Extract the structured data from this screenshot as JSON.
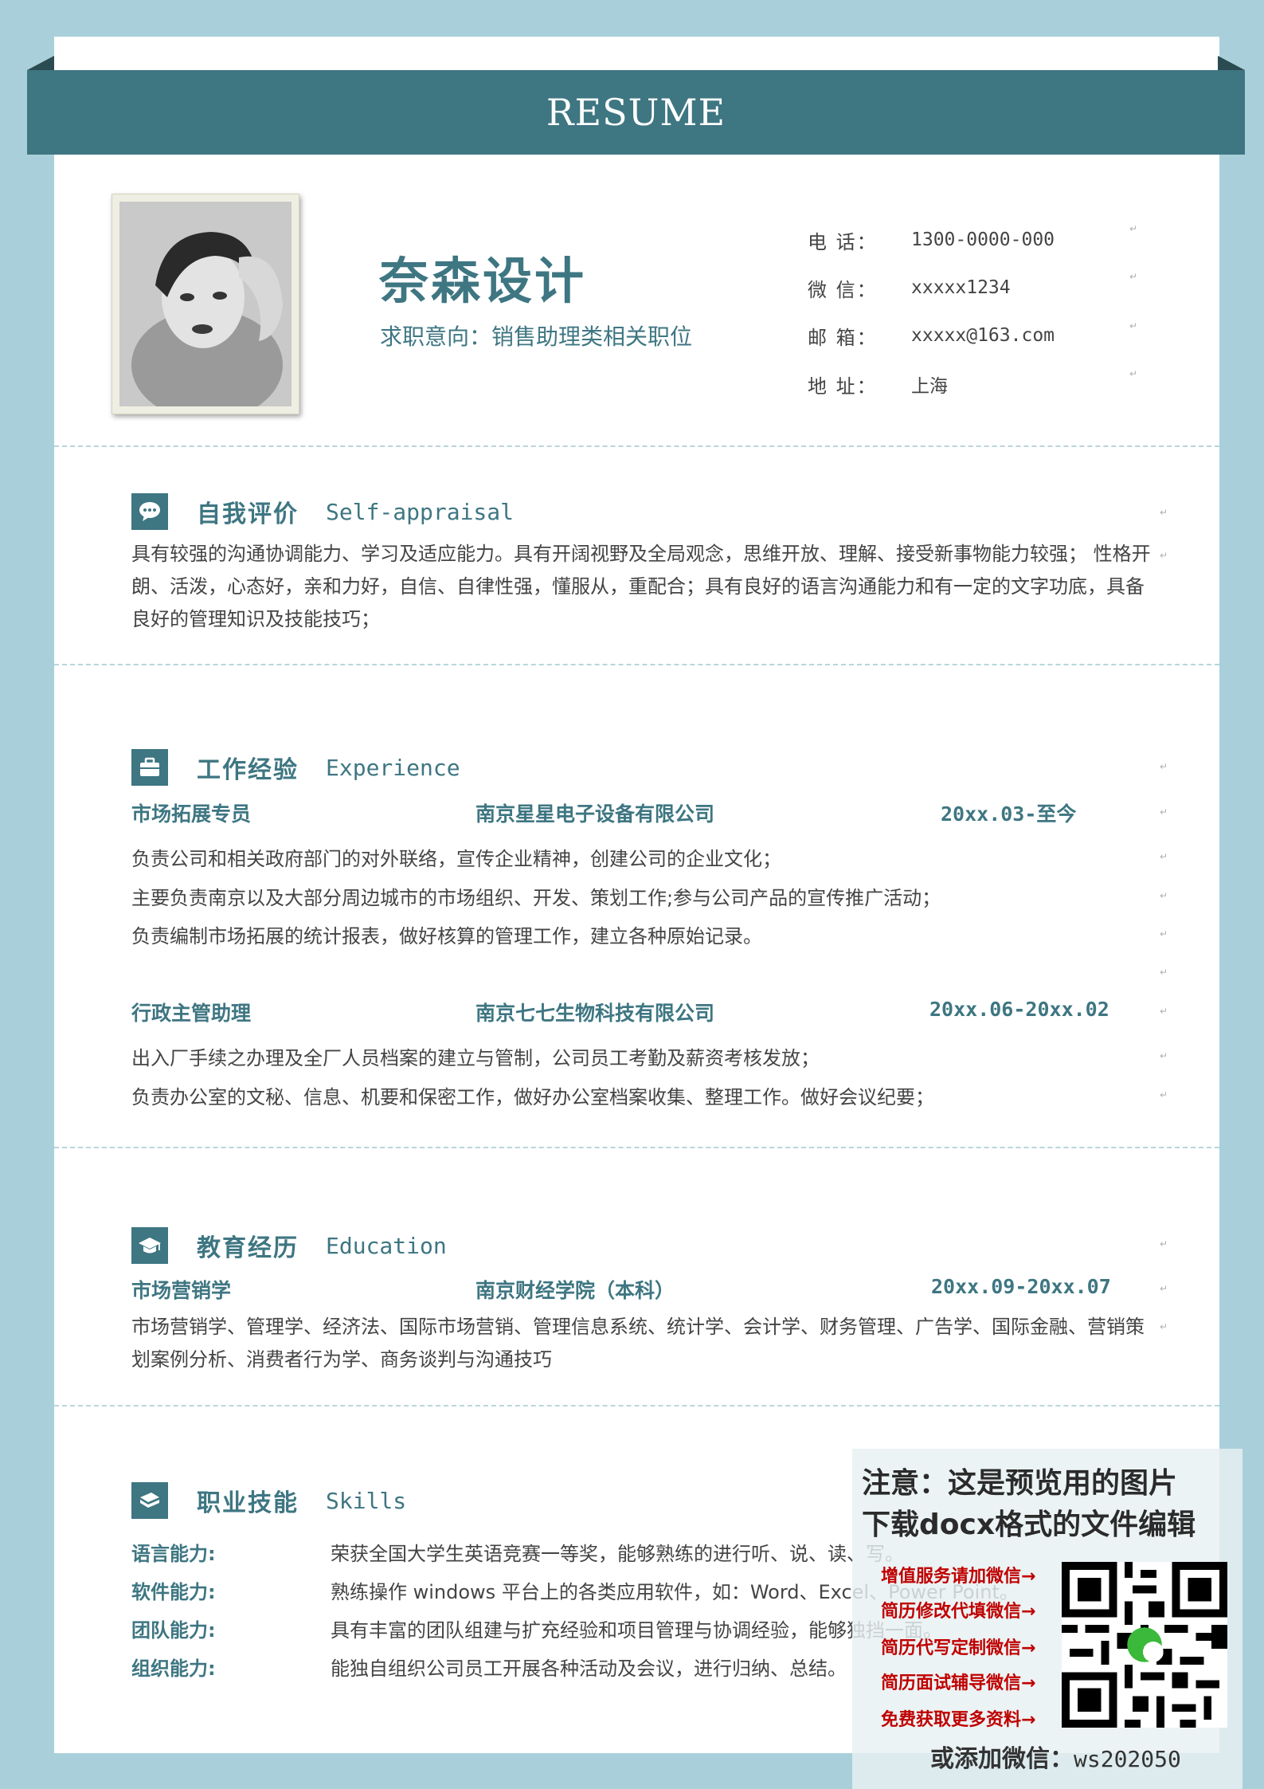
{
  "header": {
    "title": "RESUME"
  },
  "profile": {
    "name": "奈森设计",
    "intent": "求职意向：销售助理类相关职位",
    "contacts": [
      {
        "label": "电 话：",
        "value": "1300-0000-000"
      },
      {
        "label": "微 信：",
        "value": "xxxxx1234"
      },
      {
        "label": "邮 箱：",
        "value": "xxxxx@163.com"
      },
      {
        "label": "地 址：",
        "value": "上海"
      }
    ]
  },
  "self_appraisal": {
    "title_cn": "自我评价",
    "title_en": "Self-appraisal",
    "text": "具有较强的沟通协调能力、学习及适应能力。具有开阔视野及全局观念，思维开放、理解、接受新事物能力较强； 性格开朗、活泼，心态好，亲和力好，自信、自律性强，懂服从，重配合；具有良好的语言沟通能力和有一定的文字功底，具备良好的管理知识及技能技巧；"
  },
  "experience": {
    "title_cn": "工作经验",
    "title_en": "Experience",
    "jobs": [
      {
        "position": "市场拓展专员",
        "company": "南京星星电子设备有限公司",
        "period": "20xx.03-至今",
        "duties": [
          "负责公司和相关政府部门的对外联络，宣传企业精神，创建公司的企业文化；",
          "主要负责南京以及大部分周边城市的市场组织、开发、策划工作;参与公司产品的宣传推广活动；",
          "负责编制市场拓展的统计报表，做好核算的管理工作，建立各种原始记录。"
        ]
      },
      {
        "position": "行政主管助理",
        "company": "南京七七生物科技有限公司",
        "period": "20xx.06-20xx.02",
        "duties": [
          "出入厂手续之办理及全厂人员档案的建立与管制，公司员工考勤及薪资考核发放；",
          "负责办公室的文秘、信息、机要和保密工作，做好办公室档案收集、整理工作。做好会议纪要；"
        ]
      }
    ]
  },
  "education": {
    "title_cn": "教育经历",
    "title_en": "Education",
    "major": "市场营销学",
    "school": "南京财经学院（本科）",
    "period": "20xx.09-20xx.07",
    "courses": "市场营销学、管理学、经济法、国际市场营销、管理信息系统、统计学、会计学、财务管理、广告学、国际金融、营销策划案例分析、消费者行为学、商务谈判与沟通技巧"
  },
  "skills": {
    "title_cn": "职业技能",
    "title_en": "Skills",
    "items": [
      {
        "label": "语言能力:",
        "value": "荣获全国大学生英语竞赛一等奖，能够熟练的进行听、说、读、写。"
      },
      {
        "label": "软件能力:",
        "value": "熟练操作 windows 平台上的各类应用软件，如：Word、Excel、Power Point。"
      },
      {
        "label": "团队能力:",
        "value": "具有丰富的团队组建与扩充经验和项目管理与协调经验，能够独挡一面。"
      },
      {
        "label": "组织能力:",
        "value": "能独自组织公司员工开展各种活动及会议，进行归纳、总结。"
      }
    ]
  },
  "promo": {
    "title_line1": "注意：这是预览用的图片",
    "title_line2": "下载docx格式的文件编辑",
    "items": [
      "增值服务请加微信→",
      "简历修改代填微信→",
      "简历代写定制微信→",
      "简历面试辅导微信→",
      "免费获取更多资料→"
    ],
    "footer_label": "或添加微信：",
    "footer_wechat": "ws202050"
  },
  "colors": {
    "accent": "#3e7682",
    "background": "#a9d0da",
    "promo_red": "#c00000"
  }
}
